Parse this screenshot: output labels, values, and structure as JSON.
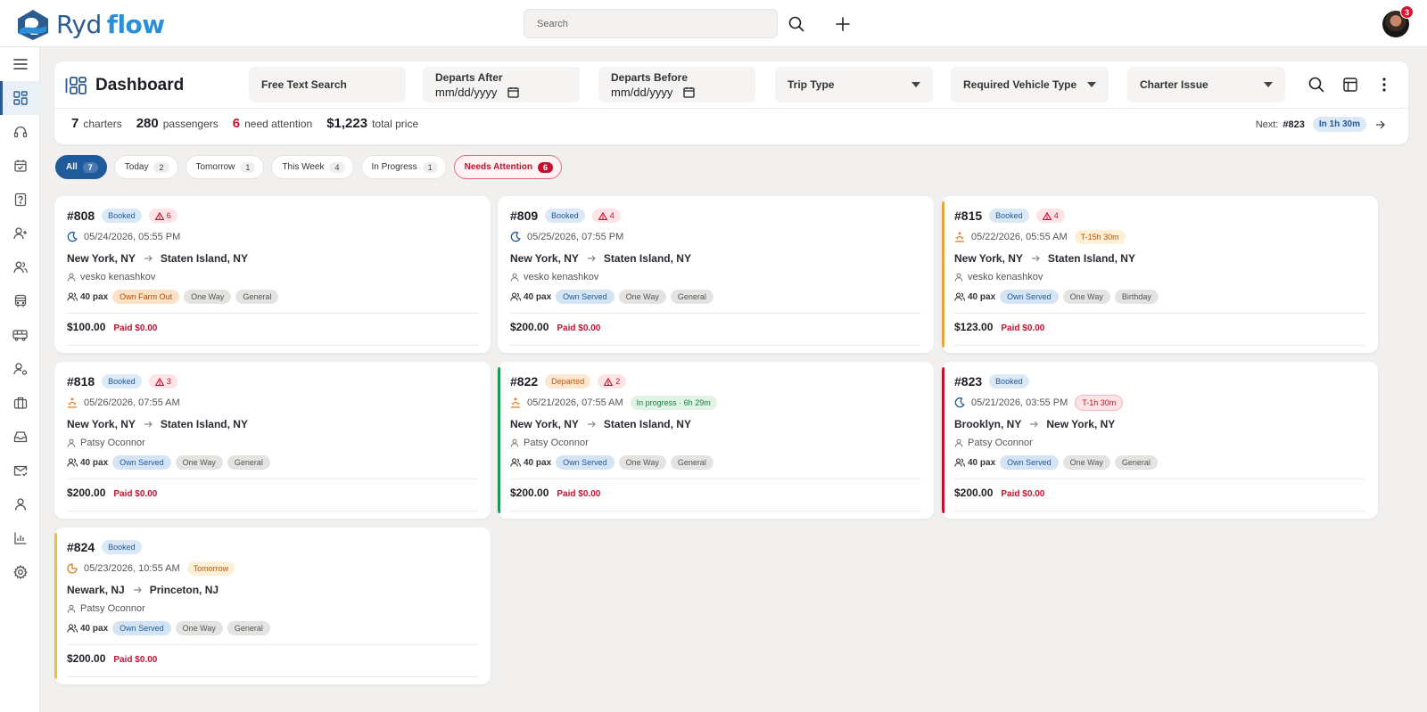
{
  "app": {
    "brand_part1": "Ryd",
    "brand_part2": "flow",
    "notifications": "3"
  },
  "header": {
    "search_placeholder": "Search"
  },
  "dashboard": {
    "title": "Dashboard",
    "filters": {
      "free_text": "Free Text Search",
      "departs_after_label": "Departs After",
      "departs_before_label": "Departs Before",
      "date_placeholder": "mm/dd/yyyy",
      "trip_type": "Trip Type",
      "vehicle_type": "Required Vehicle Type",
      "charter_issue": "Charter Issue"
    },
    "stats": {
      "charters_num": "7",
      "charters_label": "charters",
      "passengers_num": "280",
      "passengers_label": "passengers",
      "attention_num": "6",
      "attention_label": "need attention",
      "price_num": "$1,223",
      "price_label": "total price"
    },
    "next": {
      "label": "Next:",
      "id": "#823",
      "eta": "In 1h 30m"
    }
  },
  "chips": [
    {
      "label": "All",
      "count": "7"
    },
    {
      "label": "Today",
      "count": "2"
    },
    {
      "label": "Tomorrow",
      "count": "1"
    },
    {
      "label": "This Week",
      "count": "4"
    },
    {
      "label": "In Progress",
      "count": "1"
    },
    {
      "label": "Needs Attention",
      "count": "6"
    }
  ],
  "colors": {
    "brand": "#2c5c8f",
    "accent": "#2b8fd8",
    "danger": "#c8102e",
    "warning": "#e8a33a",
    "success": "#1a9a4d"
  },
  "charters": [
    {
      "id": "#808",
      "status": "Booked",
      "alerts": "6",
      "datetime": "05/24/2026, 05:55 PM",
      "time_icon": "moon-icon",
      "from": "New York, NY",
      "to": "Staten Island, NY",
      "customer": "vesko kenashkov",
      "pax": "40 pax",
      "served": "Own Farm Out",
      "trip": "One Way",
      "category": "General",
      "price": "$100.00",
      "paid": "Paid $0.00"
    },
    {
      "id": "#809",
      "status": "Booked",
      "alerts": "4",
      "datetime": "05/25/2026, 07:55 PM",
      "time_icon": "moon-icon",
      "from": "New York, NY",
      "to": "Staten Island, NY",
      "customer": "vesko kenashkov",
      "pax": "40 pax",
      "served": "Own Served",
      "trip": "One Way",
      "category": "General",
      "price": "$200.00",
      "paid": "Paid $0.00"
    },
    {
      "id": "#815",
      "status": "Booked",
      "alerts": "4",
      "datetime": "05/22/2026, 05:55 AM",
      "time_icon": "sunrise-icon",
      "extra": "T-15h 30m",
      "from": "New York, NY",
      "to": "Staten Island, NY",
      "customer": "vesko kenashkov",
      "pax": "40 pax",
      "served": "Own Served",
      "trip": "One Way",
      "category": "Birthday",
      "price": "$123.00",
      "paid": "Paid $0.00"
    },
    {
      "id": "#818",
      "status": "Booked",
      "alerts": "3",
      "datetime": "05/26/2026, 07:55 AM",
      "time_icon": "sunrise-icon",
      "from": "New York, NY",
      "to": "Staten Island, NY",
      "customer": "Patsy Oconnor",
      "pax": "40 pax",
      "served": "Own Served",
      "trip": "One Way",
      "category": "General",
      "price": "$200.00",
      "paid": "Paid $0.00"
    },
    {
      "id": "#822",
      "status": "Departed",
      "alerts": "2",
      "datetime": "05/21/2026, 07:55 AM",
      "time_icon": "sunrise-icon",
      "extra": "In progress · 6h 29m",
      "from": "New York, NY",
      "to": "Staten Island, NY",
      "customer": "Patsy Oconnor",
      "pax": "40 pax",
      "served": "Own Served",
      "trip": "One Way",
      "category": "General",
      "price": "$200.00",
      "paid": "Paid $0.00"
    },
    {
      "id": "#823",
      "status": "Booked",
      "datetime": "05/21/2026, 03:55 PM",
      "time_icon": "moon-icon",
      "extra": "T-1h 30m",
      "from": "Brooklyn, NY",
      "to": "New York, NY",
      "customer": "Patsy Oconnor",
      "pax": "40 pax",
      "served": "Own Served",
      "trip": "One Way",
      "category": "General",
      "price": "$200.00",
      "paid": "Paid $0.00"
    },
    {
      "id": "#824",
      "status": "Booked",
      "datetime": "05/23/2026, 10:55 AM",
      "time_icon": "sun-icon",
      "extra": "Tomorrow",
      "from": "Newark, NJ",
      "to": "Princeton, NJ",
      "customer": "Patsy Oconnor",
      "pax": "40 pax",
      "served": "Own Served",
      "trip": "One Way",
      "category": "General",
      "price": "$200.00",
      "paid": "Paid $0.00"
    }
  ]
}
